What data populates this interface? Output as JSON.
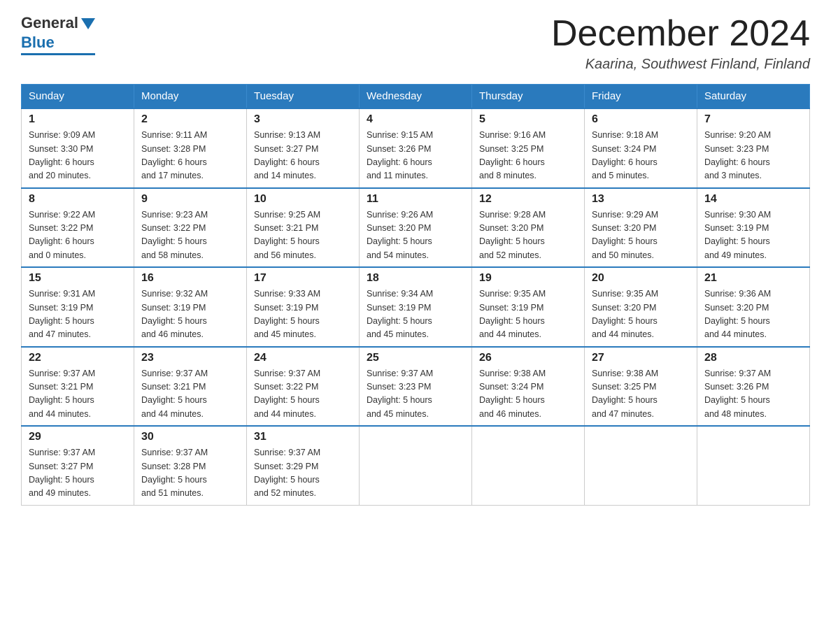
{
  "header": {
    "logo_general": "General",
    "logo_blue": "Blue",
    "month_title": "December 2024",
    "location": "Kaarina, Southwest Finland, Finland"
  },
  "days_of_week": [
    "Sunday",
    "Monday",
    "Tuesday",
    "Wednesday",
    "Thursday",
    "Friday",
    "Saturday"
  ],
  "weeks": [
    [
      {
        "day": "1",
        "sunrise": "9:09 AM",
        "sunset": "3:30 PM",
        "daylight": "6 hours",
        "daylight2": "and 20 minutes."
      },
      {
        "day": "2",
        "sunrise": "9:11 AM",
        "sunset": "3:28 PM",
        "daylight": "6 hours",
        "daylight2": "and 17 minutes."
      },
      {
        "day": "3",
        "sunrise": "9:13 AM",
        "sunset": "3:27 PM",
        "daylight": "6 hours",
        "daylight2": "and 14 minutes."
      },
      {
        "day": "4",
        "sunrise": "9:15 AM",
        "sunset": "3:26 PM",
        "daylight": "6 hours",
        "daylight2": "and 11 minutes."
      },
      {
        "day": "5",
        "sunrise": "9:16 AM",
        "sunset": "3:25 PM",
        "daylight": "6 hours",
        "daylight2": "and 8 minutes."
      },
      {
        "day": "6",
        "sunrise": "9:18 AM",
        "sunset": "3:24 PM",
        "daylight": "6 hours",
        "daylight2": "and 5 minutes."
      },
      {
        "day": "7",
        "sunrise": "9:20 AM",
        "sunset": "3:23 PM",
        "daylight": "6 hours",
        "daylight2": "and 3 minutes."
      }
    ],
    [
      {
        "day": "8",
        "sunrise": "9:22 AM",
        "sunset": "3:22 PM",
        "daylight": "6 hours",
        "daylight2": "and 0 minutes."
      },
      {
        "day": "9",
        "sunrise": "9:23 AM",
        "sunset": "3:22 PM",
        "daylight": "5 hours",
        "daylight2": "and 58 minutes."
      },
      {
        "day": "10",
        "sunrise": "9:25 AM",
        "sunset": "3:21 PM",
        "daylight": "5 hours",
        "daylight2": "and 56 minutes."
      },
      {
        "day": "11",
        "sunrise": "9:26 AM",
        "sunset": "3:20 PM",
        "daylight": "5 hours",
        "daylight2": "and 54 minutes."
      },
      {
        "day": "12",
        "sunrise": "9:28 AM",
        "sunset": "3:20 PM",
        "daylight": "5 hours",
        "daylight2": "and 52 minutes."
      },
      {
        "day": "13",
        "sunrise": "9:29 AM",
        "sunset": "3:20 PM",
        "daylight": "5 hours",
        "daylight2": "and 50 minutes."
      },
      {
        "day": "14",
        "sunrise": "9:30 AM",
        "sunset": "3:19 PM",
        "daylight": "5 hours",
        "daylight2": "and 49 minutes."
      }
    ],
    [
      {
        "day": "15",
        "sunrise": "9:31 AM",
        "sunset": "3:19 PM",
        "daylight": "5 hours",
        "daylight2": "and 47 minutes."
      },
      {
        "day": "16",
        "sunrise": "9:32 AM",
        "sunset": "3:19 PM",
        "daylight": "5 hours",
        "daylight2": "and 46 minutes."
      },
      {
        "day": "17",
        "sunrise": "9:33 AM",
        "sunset": "3:19 PM",
        "daylight": "5 hours",
        "daylight2": "and 45 minutes."
      },
      {
        "day": "18",
        "sunrise": "9:34 AM",
        "sunset": "3:19 PM",
        "daylight": "5 hours",
        "daylight2": "and 45 minutes."
      },
      {
        "day": "19",
        "sunrise": "9:35 AM",
        "sunset": "3:19 PM",
        "daylight": "5 hours",
        "daylight2": "and 44 minutes."
      },
      {
        "day": "20",
        "sunrise": "9:35 AM",
        "sunset": "3:20 PM",
        "daylight": "5 hours",
        "daylight2": "and 44 minutes."
      },
      {
        "day": "21",
        "sunrise": "9:36 AM",
        "sunset": "3:20 PM",
        "daylight": "5 hours",
        "daylight2": "and 44 minutes."
      }
    ],
    [
      {
        "day": "22",
        "sunrise": "9:37 AM",
        "sunset": "3:21 PM",
        "daylight": "5 hours",
        "daylight2": "and 44 minutes."
      },
      {
        "day": "23",
        "sunrise": "9:37 AM",
        "sunset": "3:21 PM",
        "daylight": "5 hours",
        "daylight2": "and 44 minutes."
      },
      {
        "day": "24",
        "sunrise": "9:37 AM",
        "sunset": "3:22 PM",
        "daylight": "5 hours",
        "daylight2": "and 44 minutes."
      },
      {
        "day": "25",
        "sunrise": "9:37 AM",
        "sunset": "3:23 PM",
        "daylight": "5 hours",
        "daylight2": "and 45 minutes."
      },
      {
        "day": "26",
        "sunrise": "9:38 AM",
        "sunset": "3:24 PM",
        "daylight": "5 hours",
        "daylight2": "and 46 minutes."
      },
      {
        "day": "27",
        "sunrise": "9:38 AM",
        "sunset": "3:25 PM",
        "daylight": "5 hours",
        "daylight2": "and 47 minutes."
      },
      {
        "day": "28",
        "sunrise": "9:37 AM",
        "sunset": "3:26 PM",
        "daylight": "5 hours",
        "daylight2": "and 48 minutes."
      }
    ],
    [
      {
        "day": "29",
        "sunrise": "9:37 AM",
        "sunset": "3:27 PM",
        "daylight": "5 hours",
        "daylight2": "and 49 minutes."
      },
      {
        "day": "30",
        "sunrise": "9:37 AM",
        "sunset": "3:28 PM",
        "daylight": "5 hours",
        "daylight2": "and 51 minutes."
      },
      {
        "day": "31",
        "sunrise": "9:37 AM",
        "sunset": "3:29 PM",
        "daylight": "5 hours",
        "daylight2": "and 52 minutes."
      },
      null,
      null,
      null,
      null
    ]
  ],
  "labels": {
    "sunrise": "Sunrise:",
    "sunset": "Sunset:",
    "daylight": "Daylight:"
  }
}
